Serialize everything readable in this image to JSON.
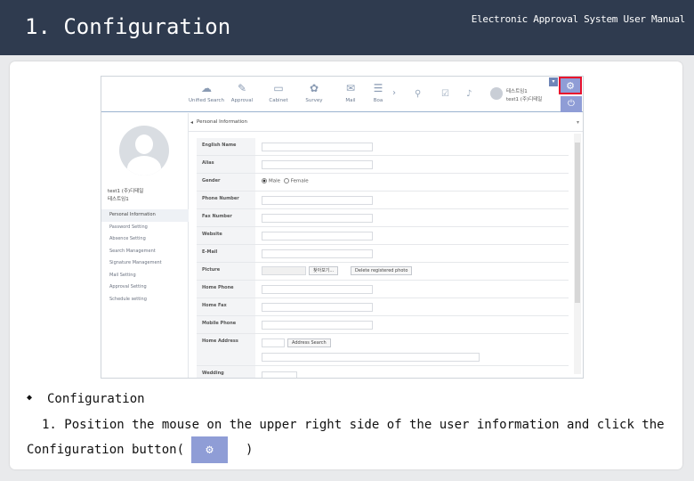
{
  "header": {
    "title": "1. Configuration",
    "subtitle": "Electronic Approval System User Manual"
  },
  "app": {
    "nav": [
      {
        "label": "Unified Search",
        "icon": "cloud-icon"
      },
      {
        "label": "Approval",
        "icon": "approval-icon"
      },
      {
        "label": "Cabinet",
        "icon": "cabinet-icon"
      },
      {
        "label": "Survey",
        "icon": "survey-icon"
      },
      {
        "label": "Mail",
        "icon": "mail-icon"
      },
      {
        "label": "Boa",
        "icon": "board-icon"
      }
    ],
    "user": {
      "name": "테스트임1",
      "org": "test1 (주)디테일"
    },
    "sidebar": {
      "profile_name": "test1 (주)디테일",
      "profile_sub": "테스트임1",
      "items": [
        "Personal Information",
        "Password Setting",
        "Absence Setting",
        "Search Management",
        "Signature Management",
        "Mail Setting",
        "Approval Setting",
        "Schedule setting"
      ]
    },
    "section_title": "Personal Information",
    "form": {
      "english_name": "English Name",
      "alias": "Alias",
      "gender": "Gender",
      "gender_male": "Male",
      "gender_female": "Female",
      "phone_number": "Phone Number",
      "fax_number": "Fax Number",
      "website": "Website",
      "email": "E-Mail",
      "picture": "Picture",
      "picture_browse": "찾아보기...",
      "picture_delete": "Delete registered photo",
      "home_phone": "Home Phone",
      "home_fax": "Home Fax",
      "mobile_phone": "Mobile Phone",
      "home_address": "Home Address",
      "address_search": "Address Search",
      "wedding": "Wedding"
    }
  },
  "instructions": {
    "heading": "Configuration",
    "line1": "1. Position the mouse on the upper right side of the user information and click the",
    "line2": "Configuration button(",
    "line2_close": ")"
  }
}
